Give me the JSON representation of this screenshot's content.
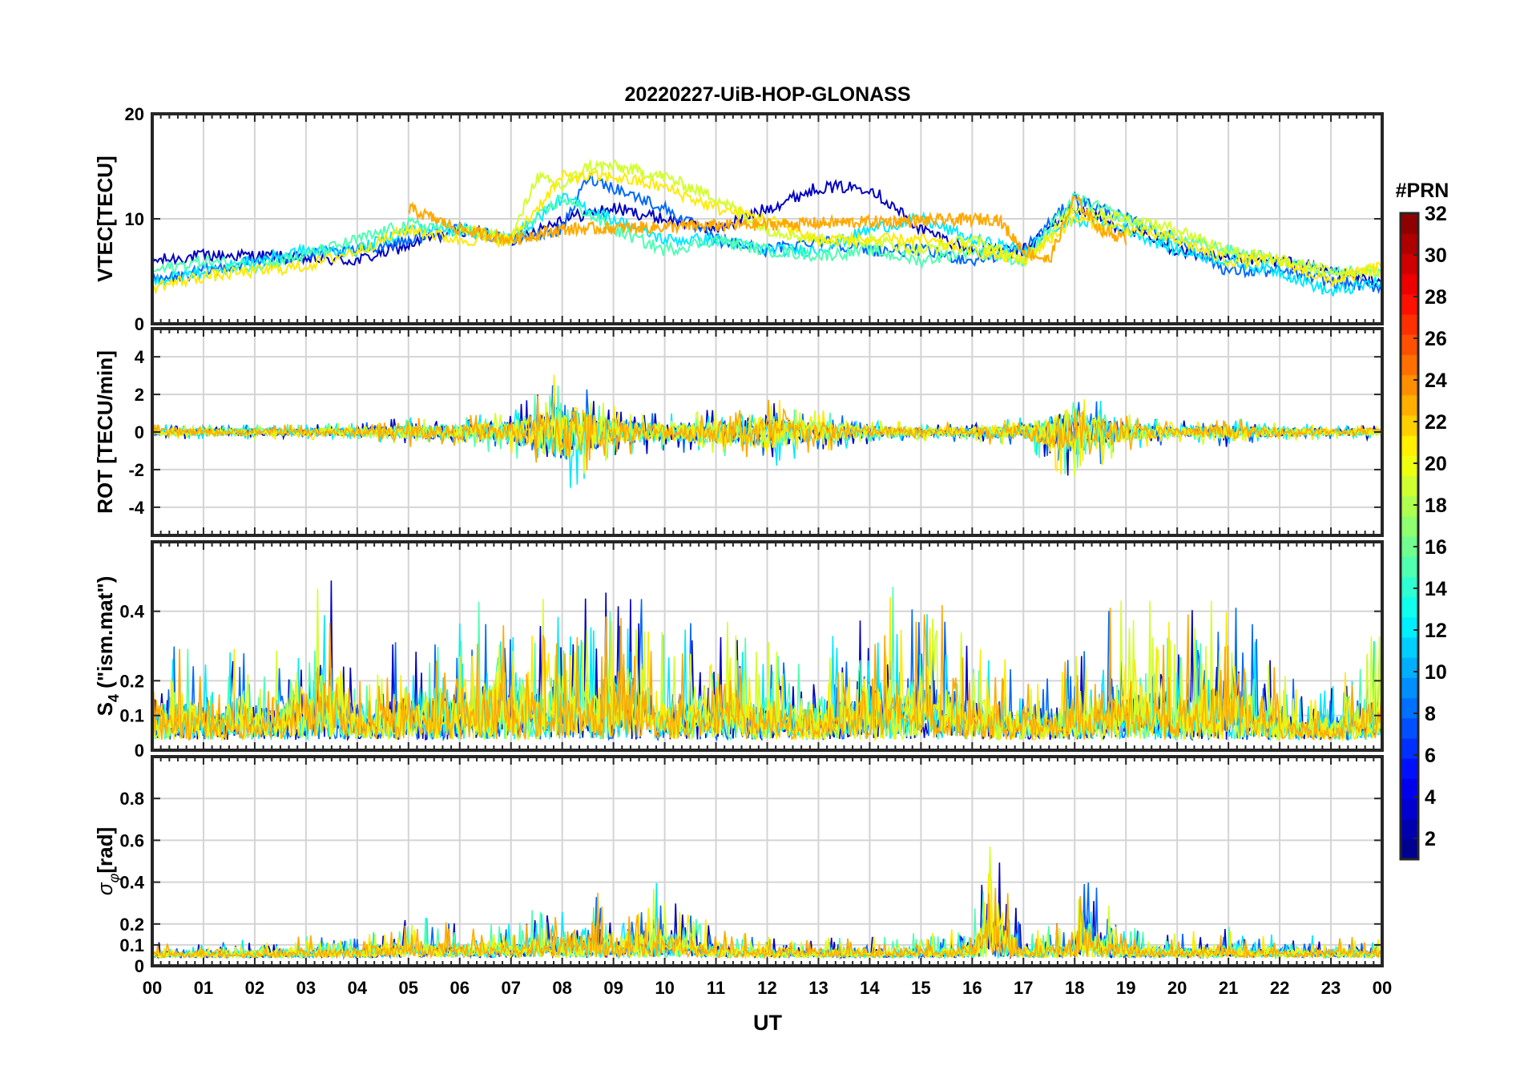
{
  "figure": {
    "title": "20220227-UiB-HOP-GLONASS",
    "xlabel": "UT",
    "xticks": [
      "00",
      "01",
      "02",
      "03",
      "04",
      "05",
      "06",
      "07",
      "08",
      "09",
      "10",
      "11",
      "12",
      "13",
      "14",
      "15",
      "16",
      "17",
      "18",
      "19",
      "20",
      "21",
      "22",
      "23",
      "00"
    ]
  },
  "colorbar": {
    "label": "#PRN",
    "ticks": [
      "2",
      "4",
      "6",
      "8",
      "10",
      "12",
      "14",
      "16",
      "18",
      "20",
      "22",
      "24",
      "26",
      "28",
      "30",
      "32"
    ],
    "range": [
      1,
      32
    ],
    "colormap": "jet"
  },
  "chart_data": [
    {
      "type": "line",
      "panel": "vtec",
      "ylabel": "VTEC[TECU]",
      "ylim": [
        0,
        20
      ],
      "yticks": [
        "0",
        "10",
        "20"
      ],
      "xlim": [
        0,
        24
      ],
      "grid": true,
      "note_color_by": "PRN",
      "series": [
        {
          "prn": 3,
          "x": [
            0,
            1,
            2,
            3,
            4,
            5,
            6,
            7,
            8,
            9,
            10,
            11,
            12,
            13,
            14,
            15,
            16,
            17,
            18,
            19,
            20,
            21,
            22,
            23,
            24
          ],
          "y": [
            6,
            6.5,
            6.5,
            6.2,
            6,
            7.5,
            9,
            8,
            10,
            11,
            10,
            9,
            11,
            13,
            13,
            9,
            7,
            7,
            11,
            9,
            7,
            6,
            6,
            5,
            4
          ]
        },
        {
          "prn": 8,
          "x": [
            0,
            2,
            4,
            6,
            7,
            8,
            8.5,
            9,
            10,
            11,
            12,
            13,
            14,
            15,
            16,
            17,
            18,
            19,
            20,
            21,
            22,
            23,
            24
          ],
          "y": [
            4,
            6,
            7,
            9,
            8,
            9,
            14,
            13,
            11,
            8,
            7,
            8,
            7,
            7,
            6,
            7,
            12,
            10,
            8,
            5,
            5,
            4,
            3.5
          ]
        },
        {
          "prn": 12,
          "x": [
            0,
            1,
            2,
            3,
            4,
            5,
            6,
            7,
            8,
            9,
            10,
            11,
            12,
            13,
            14,
            15,
            16,
            17,
            18,
            19,
            20,
            21,
            22,
            23,
            24
          ],
          "y": [
            4,
            5,
            6,
            7,
            7,
            9,
            9,
            8,
            12,
            10,
            8,
            8,
            7,
            7,
            9,
            10,
            8,
            7,
            10,
            9,
            7,
            6,
            5,
            3,
            4
          ]
        },
        {
          "prn": 15,
          "x": [
            0,
            1,
            2,
            3,
            4,
            5,
            6,
            7,
            8,
            9,
            10,
            11,
            12,
            13,
            14,
            15,
            16,
            17,
            18,
            19,
            20,
            21,
            22,
            23,
            24
          ],
          "y": [
            5,
            6,
            5.5,
            6.5,
            8,
            9.5,
            9,
            8,
            12,
            9,
            7,
            8,
            7,
            6.5,
            7,
            6,
            7,
            6,
            12,
            10,
            8,
            7,
            6,
            5,
            5
          ]
        },
        {
          "prn": 19,
          "x": [
            6,
            7,
            7.5,
            8,
            8.5,
            9,
            10,
            11,
            12,
            13,
            14,
            15,
            16,
            17,
            18,
            19,
            20,
            21,
            22,
            23,
            24
          ],
          "y": [
            9,
            8,
            14,
            13,
            15,
            15,
            14,
            12,
            9,
            8,
            8,
            7,
            8,
            6,
            11,
            10,
            9,
            7,
            6,
            5,
            5
          ]
        },
        {
          "prn": 21,
          "x": [
            0,
            1,
            2,
            3,
            4,
            5,
            6,
            7,
            8,
            9,
            10,
            11,
            12,
            13,
            14,
            15,
            16,
            17,
            18,
            19,
            20,
            21,
            22,
            23,
            24
          ],
          "y": [
            3.5,
            4.5,
            5,
            5.5,
            7,
            9,
            8,
            8,
            14,
            14,
            13,
            11,
            10,
            8,
            8,
            8,
            7,
            6,
            10,
            9,
            8,
            6,
            6,
            4,
            5.5
          ]
        },
        {
          "prn": 23,
          "x": [
            5,
            6,
            7,
            8,
            16.5,
            17,
            17.5,
            18,
            18.5,
            19
          ],
          "y": [
            11,
            9,
            8,
            9,
            10,
            7,
            6,
            12,
            9,
            8
          ]
        }
      ]
    },
    {
      "type": "line",
      "panel": "rot",
      "ylabel": "ROT [TECU/min]",
      "ylim": [
        -5.5,
        5.5
      ],
      "yticks": [
        "-4",
        "-2",
        "0",
        "2",
        "4"
      ],
      "xlim": [
        0,
        24
      ],
      "grid": true,
      "note": "high-frequency rate-of-TEC trace; enhanced activity near 05-09 UT, 12-13.5 UT and 17.5-18.5 UT, spikes to about ±4.5 TECU/min near 08 and 18 UT",
      "envelope": {
        "x": [
          0,
          2,
          4,
          5,
          6,
          7,
          8,
          9,
          10,
          11,
          12,
          13,
          14,
          15,
          16,
          17,
          18,
          19,
          20,
          21,
          22,
          23,
          24
        ],
        "amp": [
          0.4,
          0.4,
          0.5,
          0.8,
          0.9,
          1.2,
          3.5,
          1.5,
          1,
          1.3,
          2,
          1.2,
          0.7,
          0.5,
          0.6,
          0.8,
          2.8,
          1,
          0.6,
          0.8,
          0.5,
          0.4,
          0.4
        ]
      }
    },
    {
      "type": "line",
      "panel": "s4",
      "ylabel": "S4 (\"ism.mat\")",
      "ylabel_main": "S",
      "ylabel_sub": "4",
      "ylabel_rest": " (\"ism.mat\")",
      "ylim": [
        0,
        0.6
      ],
      "yticks": [
        "0",
        "0.1",
        "0.2",
        "0.4"
      ],
      "xlim": [
        0,
        24
      ],
      "grid": true,
      "note": "amplitude scintillation index; bursts up to about 0.55 near 03.5, 09.2 and 14.9 UT",
      "envelope": {
        "x": [
          0,
          1,
          2,
          3,
          3.5,
          4,
          5,
          6,
          7,
          8,
          9,
          9.2,
          10,
          11,
          12,
          13,
          14,
          15,
          16,
          17,
          18,
          19,
          20,
          21,
          22,
          23,
          24
        ],
        "amp": [
          0.25,
          0.3,
          0.25,
          0.35,
          0.55,
          0.2,
          0.35,
          0.4,
          0.45,
          0.4,
          0.45,
          0.55,
          0.3,
          0.45,
          0.3,
          0.3,
          0.4,
          0.5,
          0.3,
          0.2,
          0.25,
          0.45,
          0.35,
          0.45,
          0.2,
          0.15,
          0.35
        ]
      }
    },
    {
      "type": "line",
      "panel": "sigma_phi",
      "ylabel": "σφ[rad]",
      "ylabel_main": "σ",
      "ylabel_sub": "φ",
      "ylabel_rest": "[rad]",
      "ylim": [
        0,
        1
      ],
      "yticks": [
        "0",
        "0.1",
        "0.2",
        "0.4",
        "0.6",
        "0.8"
      ],
      "xlim": [
        0,
        24
      ],
      "grid": true,
      "note": "phase scintillation index; mostly below 0.15 rad with peaks near 16.3 UT (0.68) and 18.1 UT (0.45)",
      "envelope": {
        "x": [
          0,
          2,
          4,
          5,
          6,
          7,
          8,
          8.5,
          9,
          10,
          11,
          12,
          13,
          14,
          15,
          16,
          16.3,
          17,
          18,
          18.1,
          19,
          20,
          21,
          22,
          23,
          24
        ],
        "amp": [
          0.08,
          0.09,
          0.12,
          0.2,
          0.18,
          0.2,
          0.3,
          0.35,
          0.25,
          0.38,
          0.15,
          0.1,
          0.1,
          0.1,
          0.12,
          0.15,
          0.68,
          0.12,
          0.2,
          0.45,
          0.15,
          0.12,
          0.15,
          0.12,
          0.1,
          0.1
        ]
      }
    }
  ]
}
